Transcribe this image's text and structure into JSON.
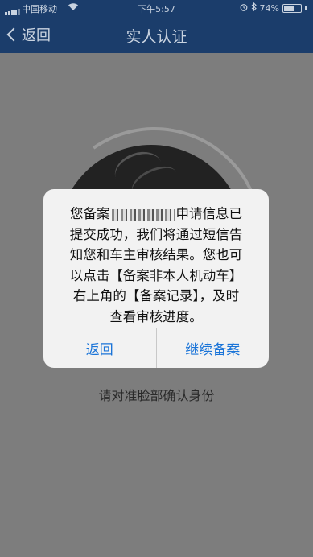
{
  "status_bar": {
    "carrier": "中国移动",
    "time": "下午5:57",
    "battery_text": "74%",
    "battery_level": 0.74
  },
  "nav": {
    "back_label": "返回",
    "title": "实人认证"
  },
  "page": {
    "hint": "请对准脸部确认身份"
  },
  "alert": {
    "line1_prefix": "您备案",
    "line1_suffix": "申请信息已",
    "line2": "提交成功，我们将通过短信告",
    "line3": "知您和车主审核结果。您也可",
    "line4": "以点击【备案非本人机动车】",
    "line5": "右上角的【备案记录】，及时",
    "line6": "查看审核进度。",
    "button_back": "返回",
    "button_continue": "继续备案"
  }
}
